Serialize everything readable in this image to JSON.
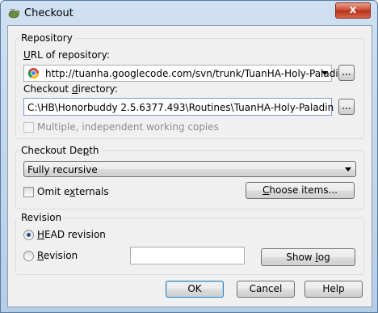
{
  "window": {
    "title": "Checkout",
    "close_label": "x"
  },
  "repository": {
    "group_label": "Repository",
    "url_label": "URL of repository:",
    "url_value": "http://tuanha.googlecode.com/svn/trunk/TuanHA-Holy-Paladin/",
    "browse_url_label": "...",
    "dir_label": "Checkout directory:",
    "dir_value": "C:\\HB\\Honorbuddy 2.5.6377.493\\Routines\\TuanHA-Holy-Paladin",
    "browse_dir_label": "...",
    "multi_label": "Multiple, independent working copies"
  },
  "depth": {
    "group_label": "Checkout Depth",
    "selected": "Fully recursive",
    "omit_label": "Omit externals",
    "choose_items_label": "Choose items..."
  },
  "revision": {
    "group_label": "Revision",
    "head_label": "HEAD revision",
    "revision_label": "Revision",
    "revision_value": "",
    "show_log_label": "Show log"
  },
  "buttons": {
    "ok": "OK",
    "cancel": "Cancel",
    "help": "Help"
  },
  "colors": {
    "frame": "#b7cde6",
    "client": "#f0f0f0",
    "accent": "#3c7fb1"
  }
}
